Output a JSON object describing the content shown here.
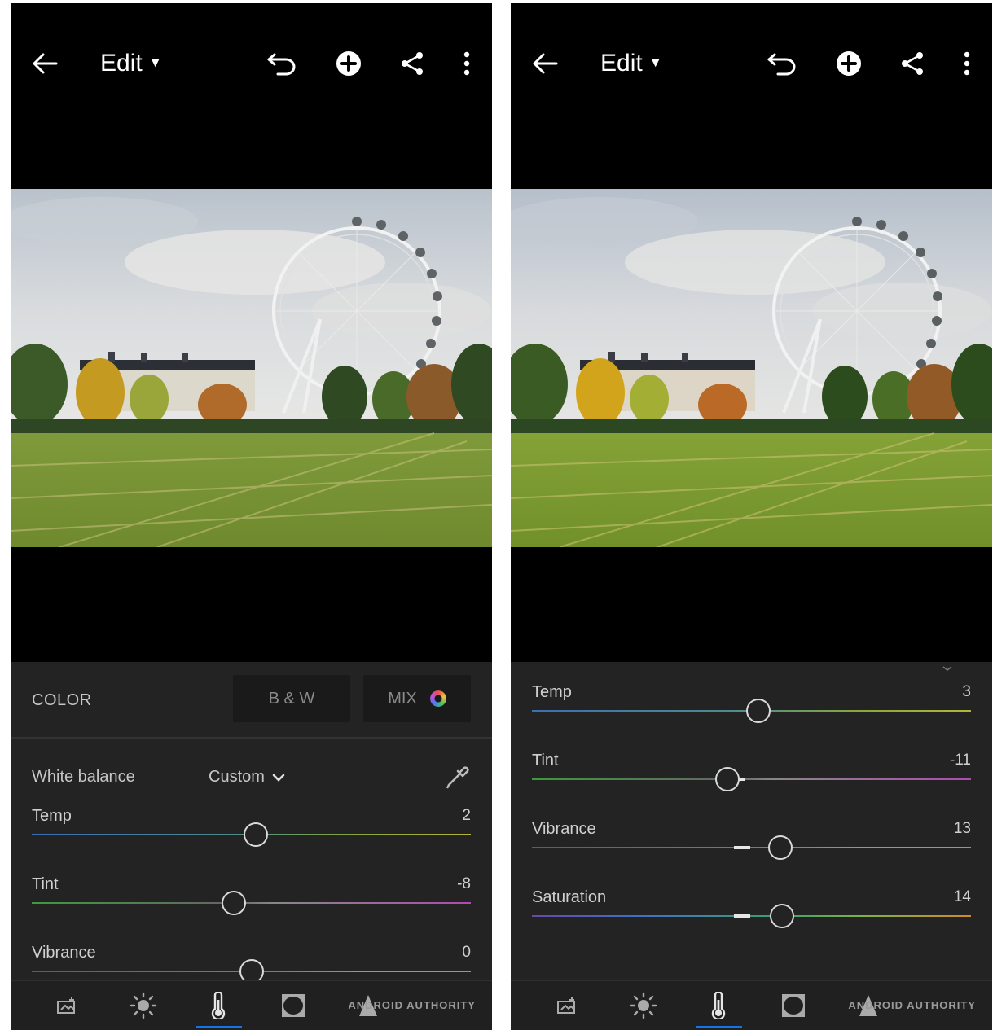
{
  "left": {
    "topbar": {
      "mode_label": "Edit"
    },
    "panel": {
      "section_label": "COLOR",
      "tabs": [
        {
          "label": "B & W"
        },
        {
          "label": "MIX"
        }
      ],
      "white_balance": {
        "label": "White balance",
        "value": "Custom"
      },
      "sliders": [
        {
          "label": "Temp",
          "value": "2",
          "position_pct": 51
        },
        {
          "label": "Tint",
          "value": "-8",
          "position_pct": 46
        },
        {
          "label": "Vibrance",
          "value": "0",
          "position_pct": 50
        }
      ]
    },
    "bottom_nav": {
      "active": "color",
      "watermark": "ANDROID AUTHORITY"
    }
  },
  "right": {
    "topbar": {
      "mode_label": "Edit"
    },
    "panel": {
      "sliders": [
        {
          "label": "Temp",
          "value": "3",
          "position_pct": 51.5
        },
        {
          "label": "Tint",
          "value": "-11",
          "position_pct": 44.5
        },
        {
          "label": "Vibrance",
          "value": "13",
          "position_pct": 56.5
        },
        {
          "label": "Saturation",
          "value": "14",
          "position_pct": 57
        }
      ]
    },
    "bottom_nav": {
      "active": "color",
      "watermark": "ANDROID AUTHORITY"
    }
  },
  "icons": {
    "back": "arrow-left-icon",
    "undo": "undo-icon",
    "add": "add-circle-icon",
    "share": "share-icon",
    "more": "more-vertical-icon",
    "picker": "eyedropper-icon",
    "nav": [
      "crop-icon",
      "light-icon",
      "color-thermometer-icon",
      "effects-vignette-icon",
      "detail-triangle-icon"
    ]
  },
  "colors": {
    "accent": "#1473e6",
    "panel_bg": "#232323",
    "app_bg": "#000000"
  }
}
